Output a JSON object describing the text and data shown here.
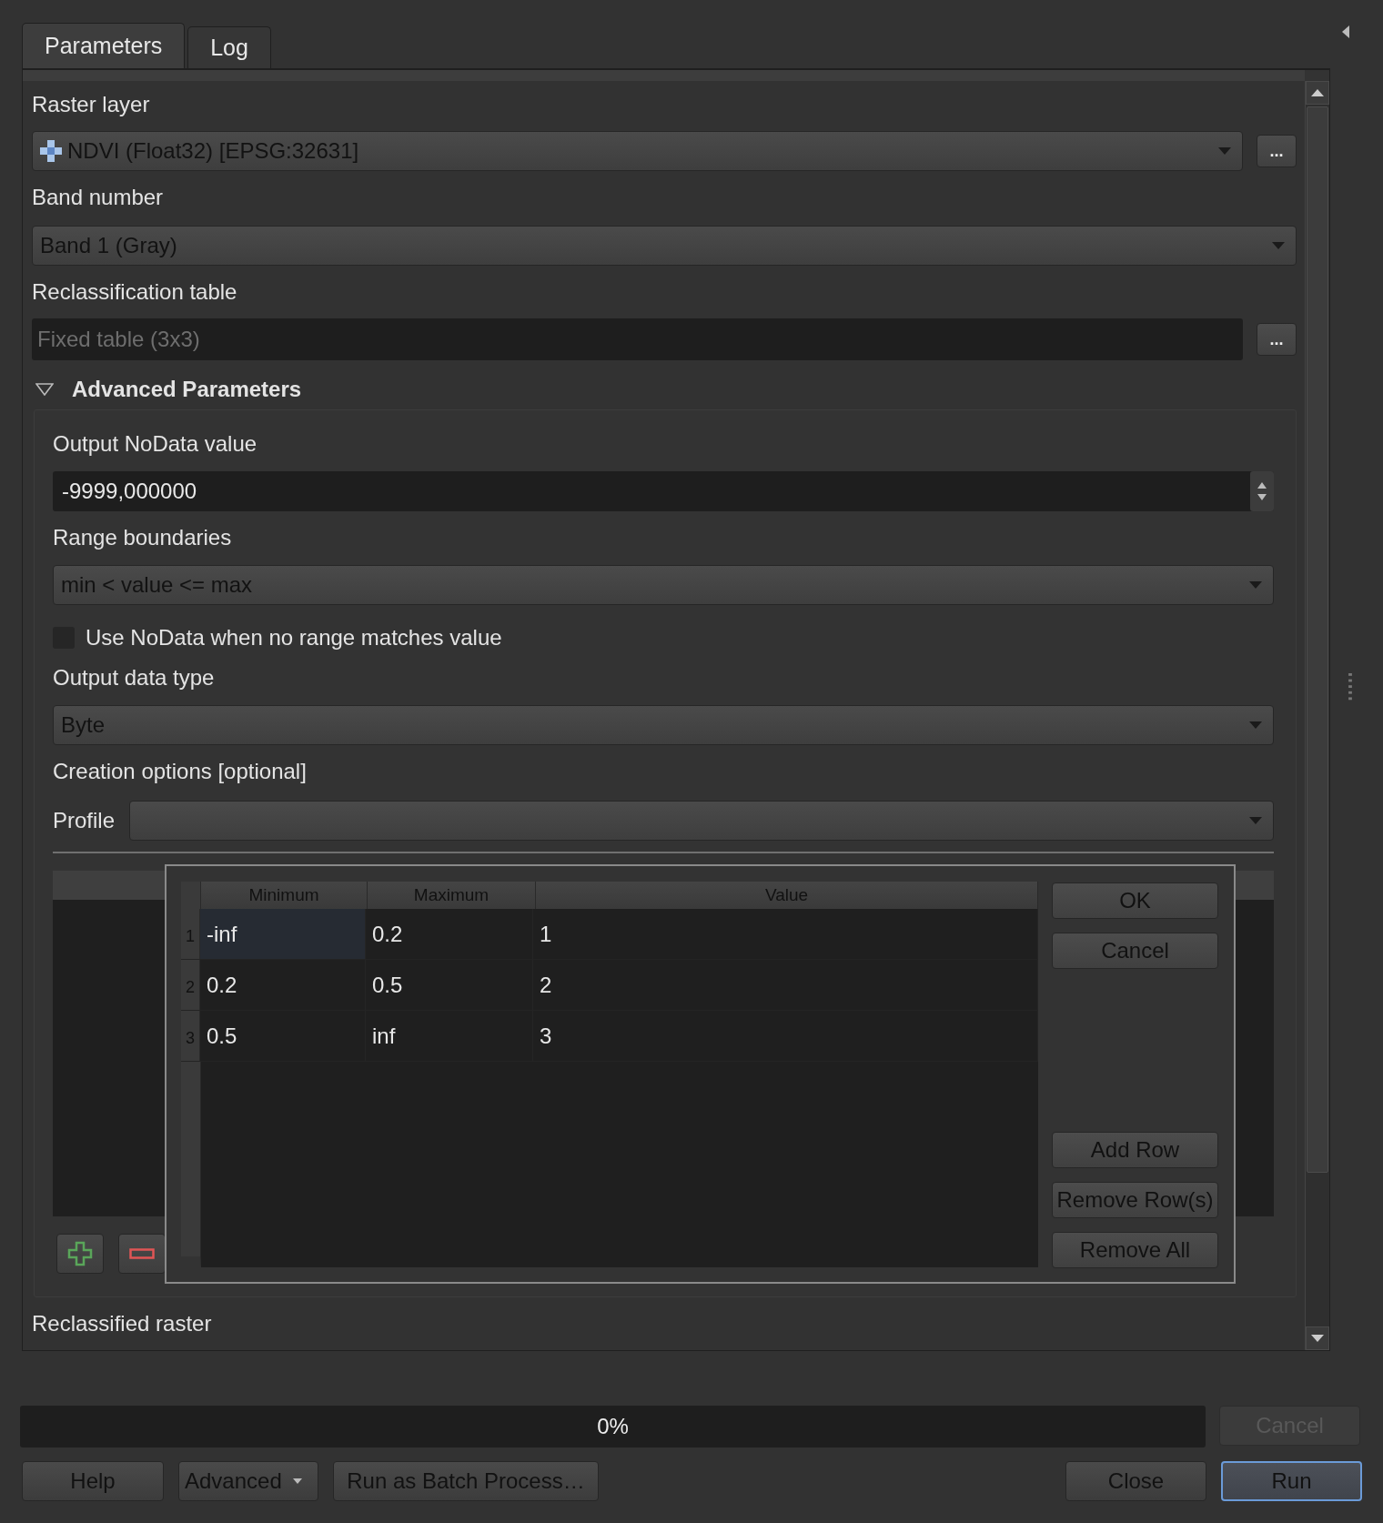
{
  "tabs": [
    {
      "label": "Parameters",
      "selected": true
    },
    {
      "label": "Log",
      "selected": false
    }
  ],
  "raster_layer": {
    "label": "Raster layer",
    "value": "NDVI (Float32) [EPSG:32631]",
    "browse": "..."
  },
  "band_number": {
    "label": "Band number",
    "value": "Band 1 (Gray)"
  },
  "reclassification_table": {
    "label": "Reclassification table",
    "placeholder": "Fixed table (3x3)",
    "browse": "..."
  },
  "advanced": {
    "label": "Advanced Parameters",
    "expanded": true,
    "output_nodata": {
      "label": "Output NoData value",
      "value": "-9999,000000"
    },
    "range_boundaries": {
      "label": "Range boundaries",
      "value": "min < value <= max"
    },
    "use_nodata": {
      "label": "Use NoData when no range matches value",
      "checked": false
    },
    "output_data_type": {
      "label": "Output data type",
      "value": "Byte"
    },
    "creation_options": {
      "label": "Creation options [optional]",
      "profile_label": "Profile"
    }
  },
  "table_dialog": {
    "columns": [
      "Minimum",
      "Maximum",
      "Value"
    ],
    "rows": [
      {
        "number": "1",
        "cells": [
          {
            "text": "-inf",
            "selected": true
          },
          {
            "text": "0.2",
            "selected": false
          },
          {
            "text": "1",
            "selected": false
          }
        ]
      },
      {
        "number": "2",
        "cells": [
          {
            "text": "0.2",
            "selected": false
          },
          {
            "text": "0.5",
            "selected": false
          },
          {
            "text": "2",
            "selected": false
          }
        ]
      },
      {
        "number": "3",
        "cells": [
          {
            "text": "0.5",
            "selected": false
          },
          {
            "text": "inf",
            "selected": false
          },
          {
            "text": "3",
            "selected": false
          }
        ]
      }
    ],
    "top_buttons": [
      "OK",
      "Cancel"
    ],
    "row_buttons": [
      "Add Row",
      "Remove Row(s)",
      "Remove All"
    ]
  },
  "reclassified_raster": {
    "label": "Reclassified raster"
  },
  "progress": {
    "level": 0,
    "text": "0%"
  },
  "cancel_button": {
    "label": "Cancel",
    "disabled": true
  },
  "left_buttons": [
    {
      "label": "Help",
      "kind": "plain"
    },
    {
      "label": "Advanced",
      "kind": "menu"
    },
    {
      "label": "Run as Batch Process…",
      "kind": "plain"
    }
  ],
  "right_buttons": [
    {
      "label": "Close",
      "default": false
    },
    {
      "label": "Run",
      "default": true
    }
  ]
}
